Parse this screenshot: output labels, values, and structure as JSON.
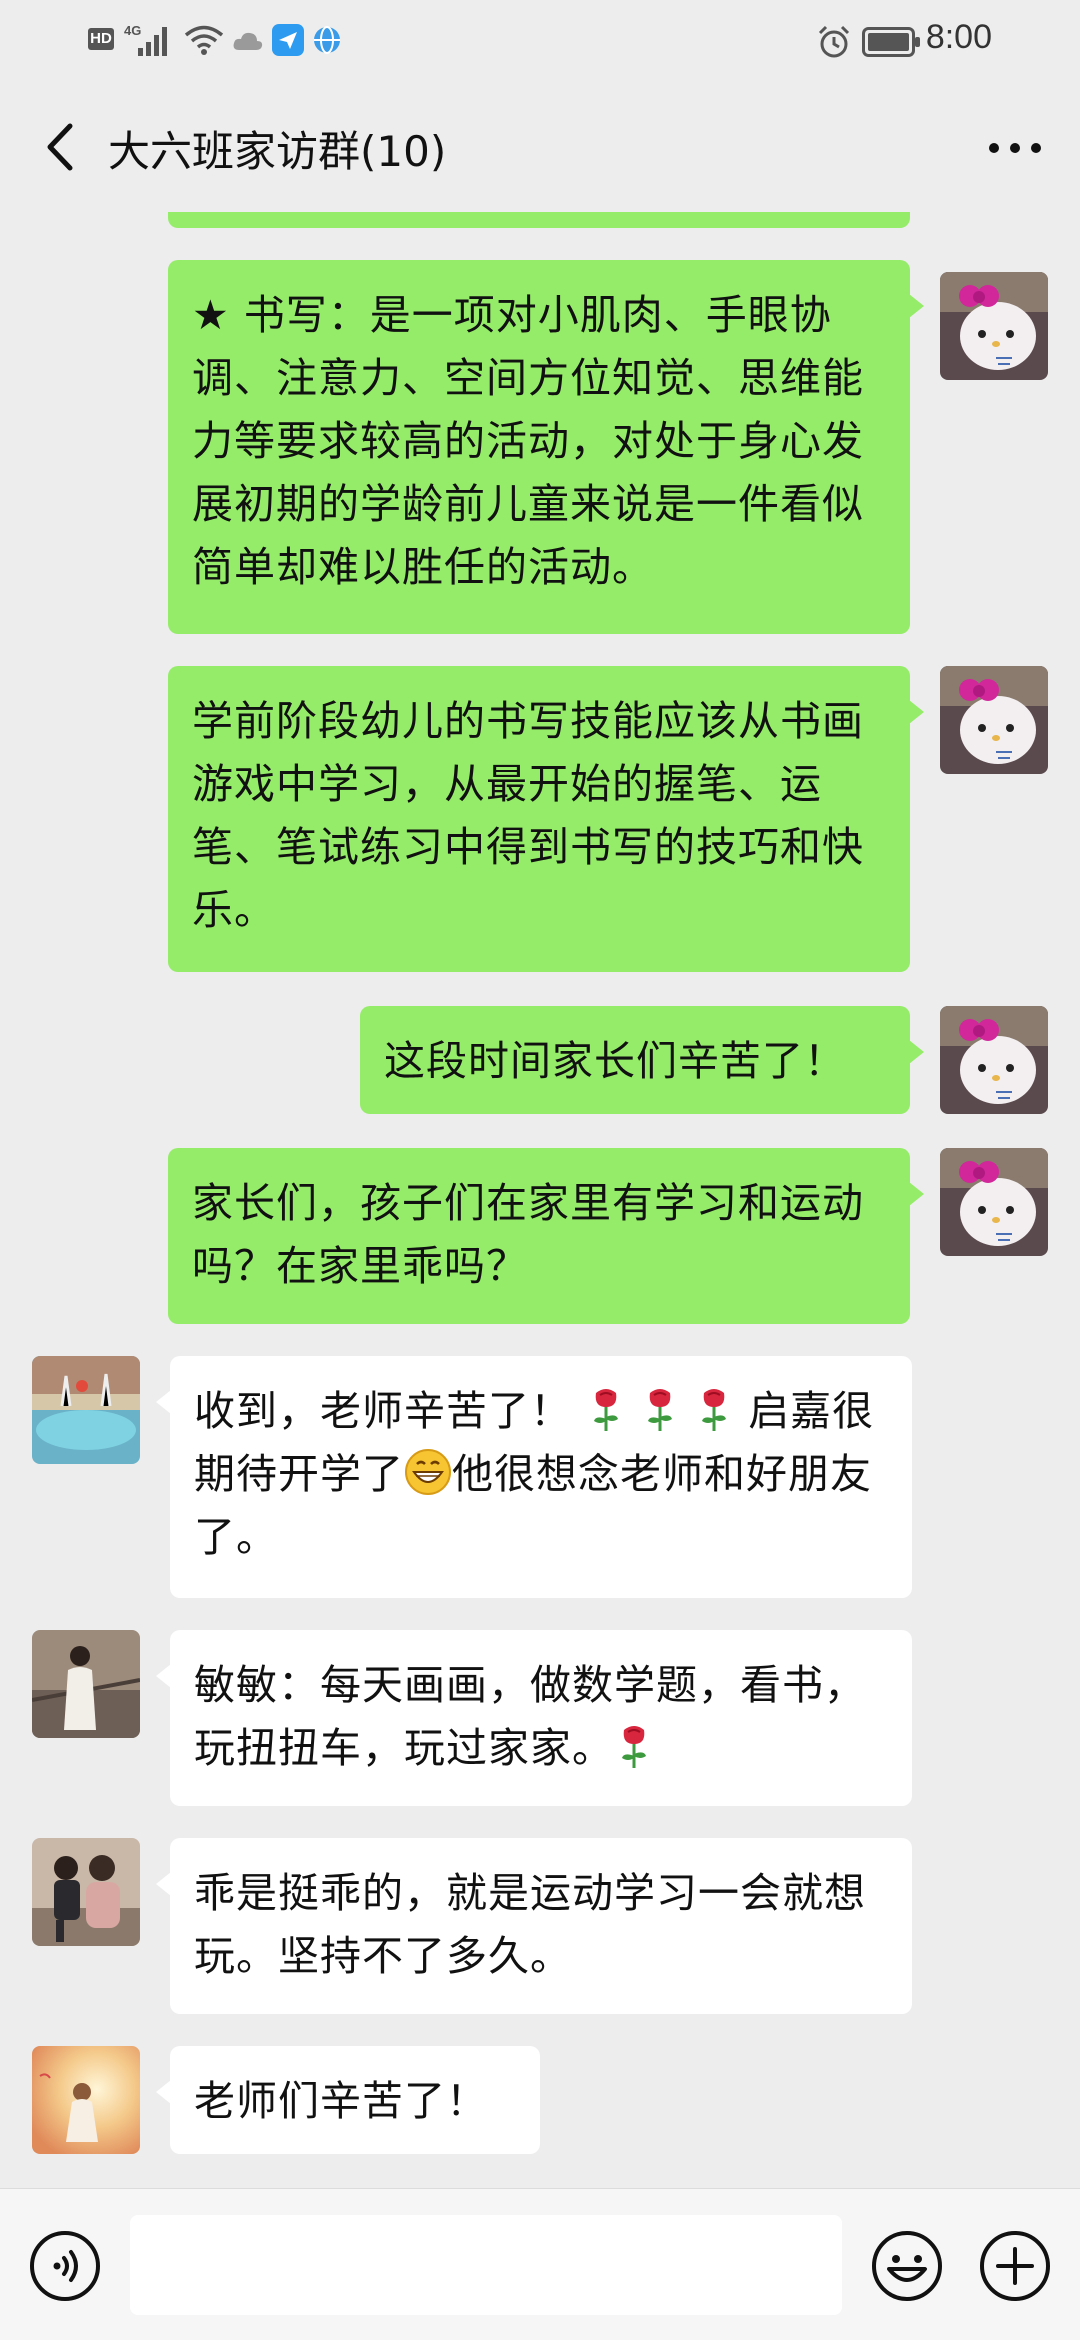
{
  "status_bar": {
    "hd_label": "HD",
    "network_label": "4G",
    "time": "8:00",
    "icons": [
      "hd-icon",
      "signal-icon",
      "wifi-icon",
      "cloud-icon",
      "app-notification-icon",
      "browser-icon",
      "alarm-icon",
      "battery-icon"
    ]
  },
  "header": {
    "title": "大六班家访群(10)",
    "back_icon": "chevron-left-icon",
    "more_icon": "more-dots-icon"
  },
  "messages": [
    {
      "direction": "sent",
      "sender": "teacher",
      "avatar": "hello-kitty-avatar",
      "text": "★ 书写：是一项对小肌肉、手眼协调、注意力、空间方位知觉、思维能力等要求较高的活动，对处于身心发展初期的学龄前儿童来说是一件看似简单却难以胜任的活动。"
    },
    {
      "direction": "sent",
      "sender": "teacher",
      "avatar": "hello-kitty-avatar",
      "text": "学前阶段幼儿的书写技能应该从书画游戏中学习，从最开始的握笔、运笔、笔试练习中得到书写的技巧和快乐。"
    },
    {
      "direction": "sent",
      "sender": "teacher",
      "avatar": "hello-kitty-avatar",
      "text": "这段时间家长们辛苦了！"
    },
    {
      "direction": "sent",
      "sender": "teacher",
      "avatar": "hello-kitty-avatar",
      "text": "家长们，孩子们在家里有学习和运动吗？在家里乖吗？"
    },
    {
      "direction": "received",
      "sender": "parent-1",
      "avatar": "fountain-photo-avatar",
      "text_part1": "收到，老师辛苦了！",
      "text_part2": "启嘉很期待开学了",
      "text_part3": "他很想念老师和好朋友了。",
      "emoji": [
        "rose-icon",
        "rose-icon",
        "rose-icon",
        "grinning-face-icon"
      ]
    },
    {
      "direction": "received",
      "sender": "parent-2",
      "avatar": "woman-portrait-avatar",
      "text": "敏敏：每天画画，做数学题，看书，玩扭扭车，玩过家家。",
      "emoji": [
        "rose-icon"
      ]
    },
    {
      "direction": "received",
      "sender": "parent-3",
      "avatar": "two-children-avatar",
      "text": "乖是挺乖的，就是运动学习一会就想玩。坚持不了多久。"
    },
    {
      "direction": "received",
      "sender": "parent-4",
      "avatar": "sunset-girl-avatar",
      "text": "老师们辛苦了！"
    }
  ],
  "input_bar": {
    "voice_icon": "voice-icon",
    "emoji_icon": "emoji-icon",
    "plus_icon": "plus-circle-icon",
    "placeholder": ""
  },
  "colors": {
    "background": "#ededed",
    "sent_bubble": "#95ec69",
    "received_bubble": "#ffffff",
    "text": "#111111"
  }
}
